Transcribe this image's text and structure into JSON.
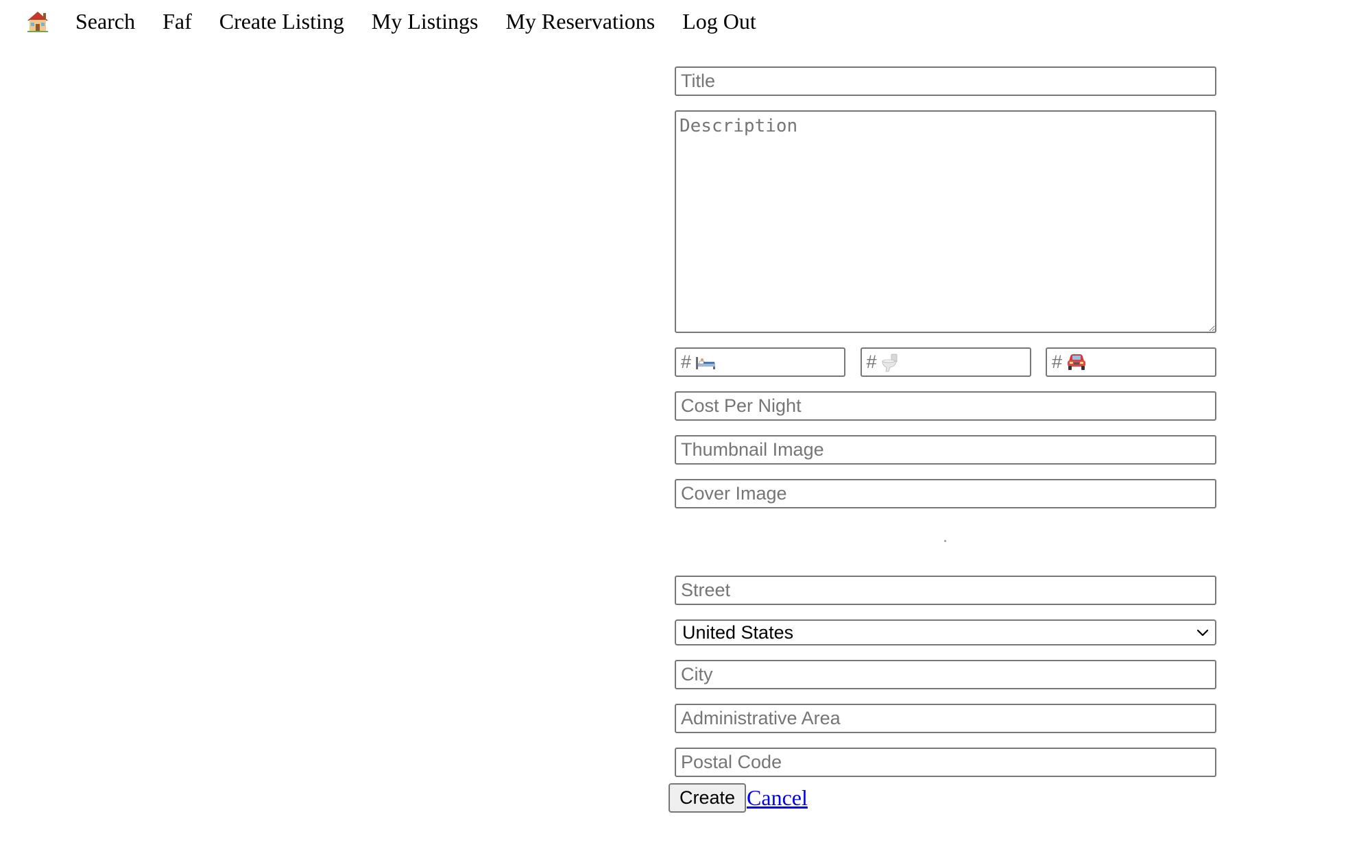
{
  "nav": {
    "home_icon": "house-emoji-icon",
    "items": [
      {
        "label": "Search"
      },
      {
        "label": "Faf"
      },
      {
        "label": "Create Listing"
      },
      {
        "label": "My Listings"
      },
      {
        "label": "My Reservations"
      },
      {
        "label": "Log Out"
      }
    ]
  },
  "form": {
    "title": {
      "placeholder": "Title",
      "value": ""
    },
    "description": {
      "placeholder": "Description",
      "value": ""
    },
    "counts": [
      {
        "placeholder": "#",
        "icon": "bed-icon",
        "value": ""
      },
      {
        "placeholder": "#",
        "icon": "toilet-icon",
        "value": ""
      },
      {
        "placeholder": "#",
        "icon": "car-icon",
        "value": ""
      }
    ],
    "cost_per_night": {
      "placeholder": "Cost Per Night",
      "value": ""
    },
    "thumbnail_image": {
      "placeholder": "Thumbnail Image",
      "value": ""
    },
    "cover_image": {
      "placeholder": "Cover Image",
      "value": ""
    },
    "street": {
      "placeholder": "Street",
      "value": ""
    },
    "country": {
      "selected": "United States"
    },
    "city": {
      "placeholder": "City",
      "value": ""
    },
    "administrative_area": {
      "placeholder": "Administrative Area",
      "value": ""
    },
    "postal_code": {
      "placeholder": "Postal Code",
      "value": ""
    },
    "create_label": "Create",
    "cancel_label": "Cancel"
  },
  "colors": {
    "border": "#767676",
    "placeholder": "#757575",
    "button_bg": "#efefef",
    "link": "#0000ee"
  }
}
